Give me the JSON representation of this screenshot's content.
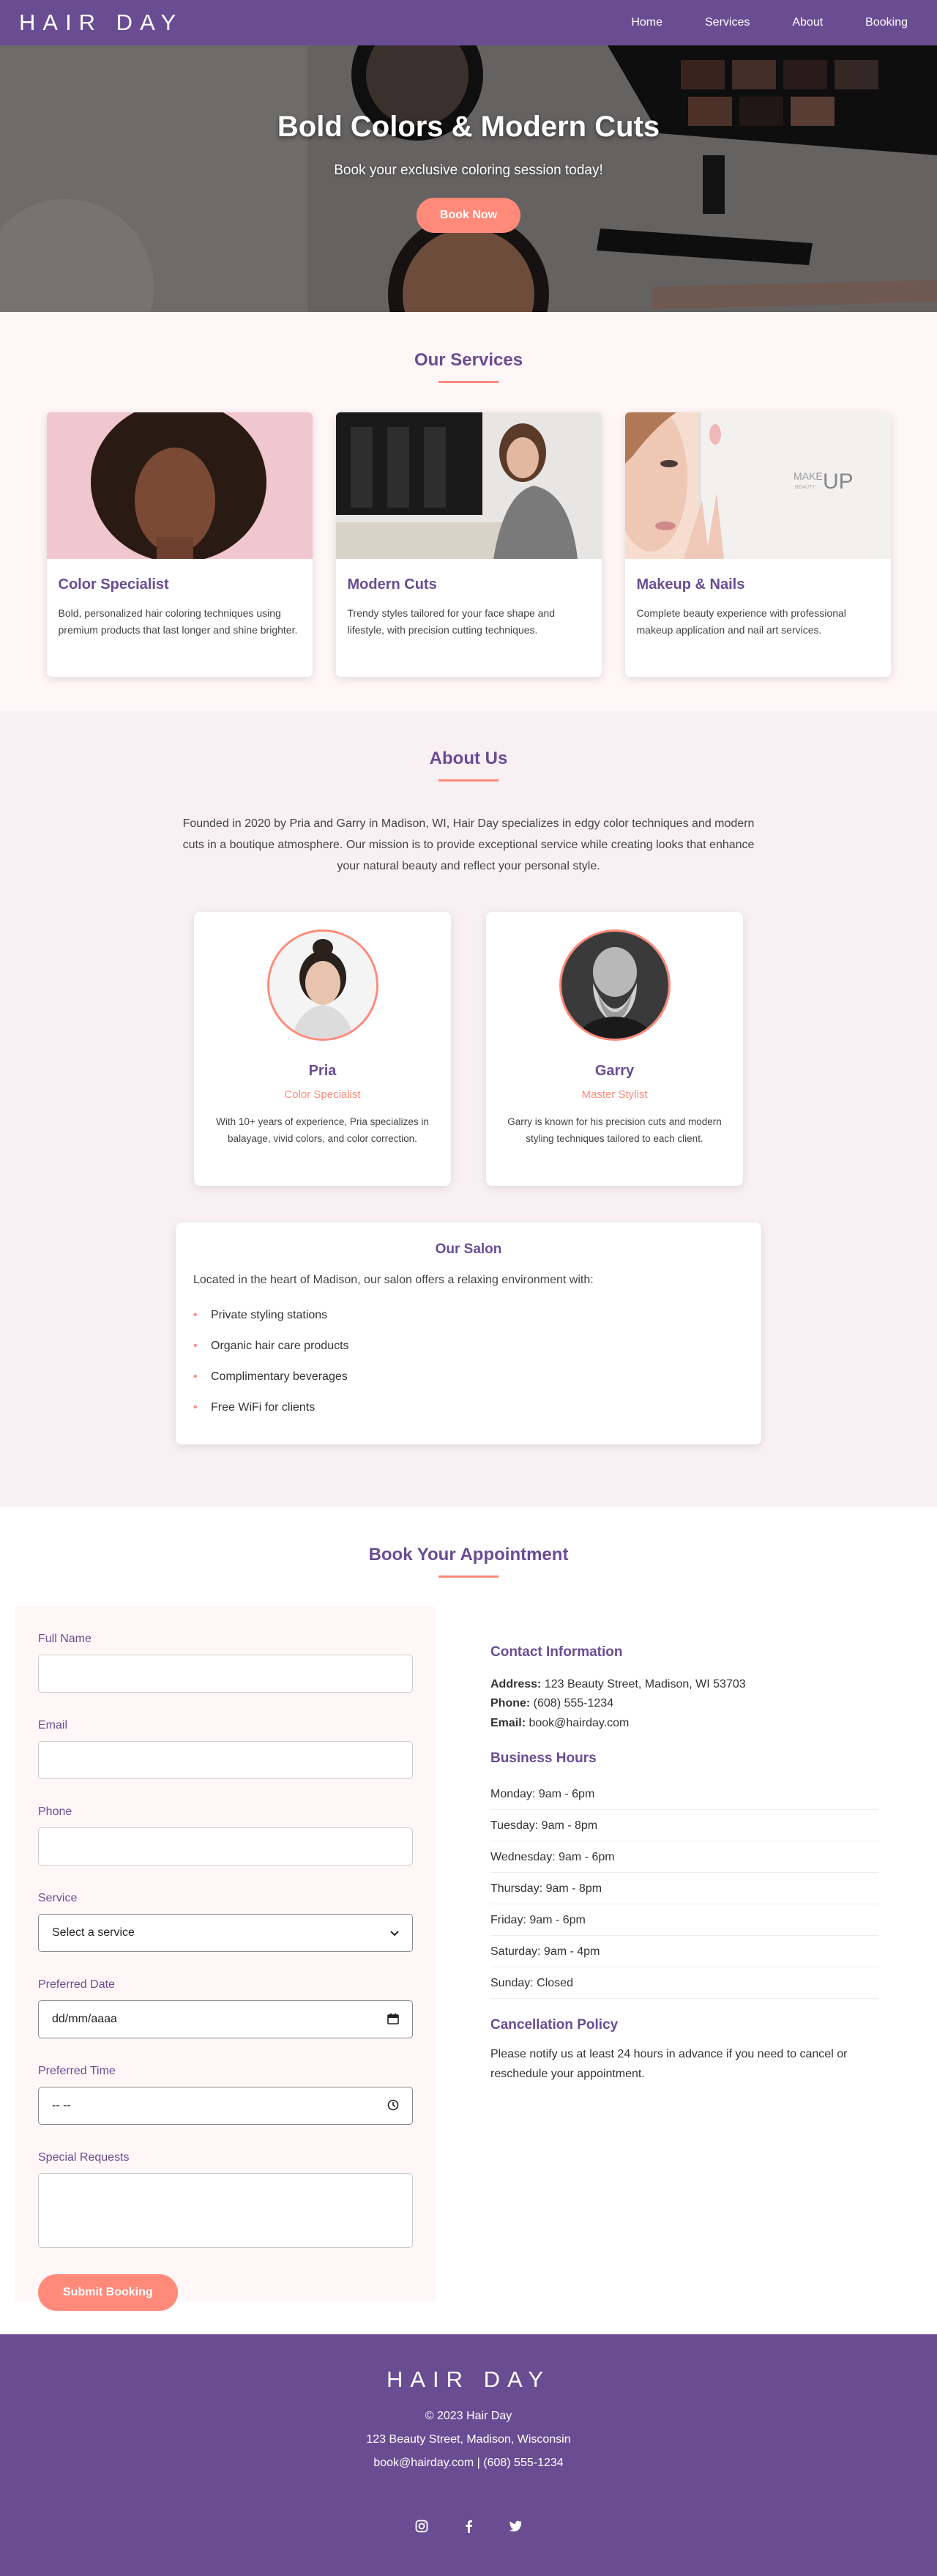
{
  "nav": {
    "logo": "HAIR DAY",
    "links": [
      "Home",
      "Services",
      "About",
      "Booking"
    ]
  },
  "hero": {
    "title": "Bold Colors & Modern Cuts",
    "subtitle": "Book your exclusive coloring session today!",
    "button": "Book Now"
  },
  "services": {
    "title": "Our Services",
    "items": [
      {
        "title": "Color Specialist",
        "text": "Bold, personalized hair coloring techniques using premium products that last longer and shine brighter."
      },
      {
        "title": "Modern Cuts",
        "text": "Trendy styles tailored for your face shape and lifestyle, with precision cutting techniques."
      },
      {
        "title": "Makeup & Nails",
        "text": "Complete beauty experience with professional makeup application and nail art services."
      }
    ],
    "makeup_image_text": {
      "line1": "MAKE",
      "line2": "UP",
      "small": "BEAUTY"
    }
  },
  "about": {
    "title": "About Us",
    "text": "Founded in 2020 by Pria and Garry in Madison, WI, Hair Day specializes in edgy color techniques and modern cuts in a boutique atmosphere. Our mission is to provide exceptional service while creating looks that enhance your natural beauty and reflect your personal style.",
    "team": [
      {
        "name": "Pria",
        "role": "Color Specialist",
        "bio": "With 10+ years of experience, Pria specializes in balayage, vivid colors, and color correction."
      },
      {
        "name": "Garry",
        "role": "Master Stylist",
        "bio": "Garry is known for his precision cuts and modern styling techniques tailored to each client."
      }
    ],
    "salon": {
      "title": "Our Salon",
      "intro": "Located in the heart of Madison, our salon offers a relaxing environment with:",
      "features": [
        "Private styling stations",
        "Organic hair care products",
        "Complimentary beverages",
        "Free WiFi for clients"
      ]
    }
  },
  "booking": {
    "title": "Book Your Appointment",
    "form": {
      "full_name_label": "Full Name",
      "email_label": "Email",
      "phone_label": "Phone",
      "service_label": "Service",
      "service_value": "Select a service",
      "date_label": "Preferred Date",
      "date_placeholder": "dd/mm/aaaa",
      "time_label": "Preferred Time",
      "time_placeholder": "-- --",
      "requests_label": "Special Requests",
      "submit": "Submit Booking"
    },
    "contact": {
      "title": "Contact Information",
      "address_label": "Address:",
      "address": "123 Beauty Street, Madison, WI 53703",
      "phone_label": "Phone:",
      "phone": "(608) 555-1234",
      "email_label": "Email:",
      "email": "book@hairday.com"
    },
    "hours": {
      "title": "Business Hours",
      "days": [
        "Monday: 9am - 6pm",
        "Tuesday: 9am - 8pm",
        "Wednesday: 9am - 6pm",
        "Thursday: 9am - 8pm",
        "Friday: 9am - 6pm",
        "Saturday: 9am - 4pm",
        "Sunday: Closed"
      ]
    },
    "policy": {
      "title": "Cancellation Policy",
      "text": "Please notify us at least 24 hours in advance if you need to cancel or reschedule your appointment."
    }
  },
  "footer": {
    "logo": "HAIR DAY",
    "copyright": "© 2023 Hair Day",
    "address": "123 Beauty Street, Madison, Wisconsin",
    "contact": "book@hairday.com | (608) 555-1234",
    "social": [
      "instagram-icon",
      "facebook-icon",
      "twitter-icon"
    ]
  },
  "colors": {
    "primary": "#6a4c93",
    "accent": "#ff8a7a",
    "light_pink": "#fff6f7"
  }
}
